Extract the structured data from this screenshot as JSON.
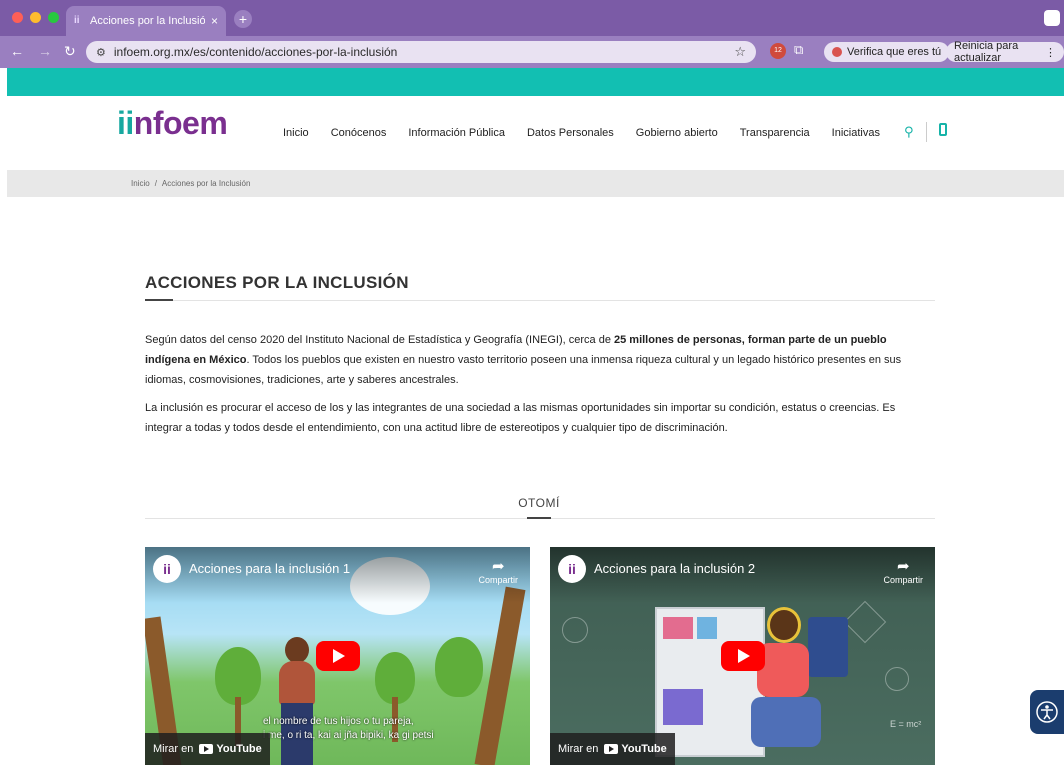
{
  "browser": {
    "tab_title": "Acciones por la Inclusión | Inf",
    "tab_close": "×",
    "new_tab": "+",
    "url": "infoem.org.mx/es/contenido/acciones-por-la-inclusión",
    "ext_badge": "12",
    "verify_label": "Verifica que eres tú",
    "restart_label": "Reinicia para actualizar",
    "menu_icon": "⋮"
  },
  "header": {
    "logo_prefix": "ii",
    "logo_text": "nfoem",
    "nav": [
      "Inicio",
      "Conócenos",
      "Información Pública",
      "Datos Personales",
      "Gobierno abierto",
      "Transparencia",
      "Iniciativas"
    ]
  },
  "breadcrumb": {
    "home": "Inicio",
    "separator": "/",
    "current": "Acciones por la Inclusión"
  },
  "content": {
    "title": "ACCIONES POR LA INCLUSIÓN",
    "p1_a": "Según datos del censo 2020 del Instituto Nacional de Estadística y Geografía (INEGI), cerca de ",
    "p1_bold": "25 millones de personas, forman parte de un pueblo indígena en México",
    "p1_b": ". Todos los pueblos que existen en nuestro vasto territorio poseen una inmensa riqueza cultural y un legado histórico presentes en sus idiomas, cosmovisiones, tradiciones, arte y saberes ancestrales.",
    "p2": "La inclusión es procurar el acceso de los y las integrantes de una sociedad a las mismas oportunidades sin importar su condición, estatus o creencias. Es integrar a todas y todos desde el entendimiento, con una actitud libre de estereotipos y cualquier tipo de discriminación.",
    "section": "OTOMÍ"
  },
  "videos": [
    {
      "title": "Acciones para la inclusión 1",
      "share": "Compartir",
      "watch": "Mirar en",
      "yt": "YouTube",
      "caption_1": "el nombre de tus hijos o tu pareja,",
      "caption_2": "i me, o ri ta, kai ai jña bipiki, ka gi petsi"
    },
    {
      "title": "Acciones para la inclusión 2",
      "share": "Compartir",
      "watch": "Mirar en",
      "yt": "YouTube",
      "board_text": "E = mc²"
    }
  ]
}
